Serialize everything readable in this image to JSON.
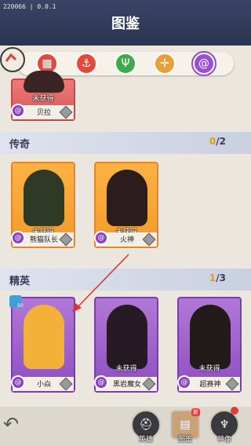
{
  "header": {
    "version": "220066 | 0.0.1",
    "title": "图鉴"
  },
  "filter_tabs": [
    {
      "icon": "grid-icon",
      "color": "#e14a3c",
      "glyph": "▦",
      "selected": false
    },
    {
      "icon": "anchor-icon",
      "color": "#e14a3c",
      "glyph": "⚓",
      "selected": false
    },
    {
      "icon": "trident-icon",
      "color": "#3fa94b",
      "glyph": "Ψ",
      "selected": false
    },
    {
      "icon": "crosshair-icon",
      "color": "#e8a13a",
      "glyph": "✛",
      "selected": false
    },
    {
      "icon": "spiral-icon",
      "color": "#9b4fd3",
      "glyph": "@",
      "selected": true
    }
  ],
  "top_card": {
    "status": "未获得",
    "name": "贝拉"
  },
  "sections": {
    "legend": {
      "label": "传奇",
      "got": "0",
      "total": "/2",
      "cards": [
        {
          "status": "未获得",
          "name": "熊猫队长"
        },
        {
          "status": "未获得",
          "name": "火神"
        }
      ]
    },
    "elite": {
      "label": "精英",
      "got": "1",
      "total": "/3",
      "cards": [
        {
          "status": "",
          "name": "小焱",
          "level": "50"
        },
        {
          "status": "未获得",
          "name": "黑岩魔女"
        },
        {
          "status": "未获得",
          "name": "超赛神"
        }
      ]
    }
  },
  "bottom_nav": {
    "heroes": "英雄",
    "codex": "图鉴",
    "codex_badge": "新",
    "statue": "神像"
  },
  "colors": {
    "gold": "#f29a2a",
    "purple": "#8e4ec0",
    "accent_arrow": "#e03030"
  }
}
